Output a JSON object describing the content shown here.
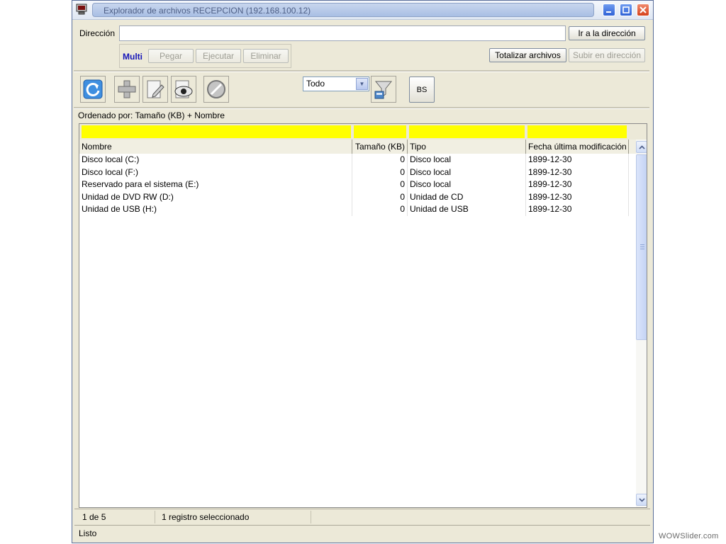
{
  "window": {
    "title": "Explorador de archivos RECEPCION (192.168.100.12)",
    "controls": {
      "minimize": "_",
      "maximize": "□",
      "close": "X"
    }
  },
  "address": {
    "label": "Dirección",
    "value": "",
    "go_button": "Ir a la dirección"
  },
  "multi": {
    "label": "Multi",
    "buttons": [
      "Pegar",
      "Ejecutar",
      "Eliminar"
    ]
  },
  "actions": {
    "totalize": "Totalizar archivos",
    "go_up": "Subir en dirección"
  },
  "toolbar": {
    "icons": [
      "refresh-icon",
      "add-icon",
      "edit-icon",
      "view-icon",
      "cancel-icon"
    ],
    "filter_select": "Todo",
    "filter_icon": "filter-icon",
    "bs_button": "BS"
  },
  "sort": {
    "text": "Ordenado por: Tamaño (KB)  +  Nombre"
  },
  "grid": {
    "columns": [
      "Nombre",
      "Tamaño (KB)",
      "Tipo",
      "Fecha última modificación"
    ],
    "rows": [
      [
        "Disco local (C:)",
        "0",
        "Disco local",
        "1899-12-30"
      ],
      [
        "Disco local (F:)",
        "0",
        "Disco local",
        "1899-12-30"
      ],
      [
        "Reservado para el sistema (E:)",
        "0",
        "Disco local",
        "1899-12-30"
      ],
      [
        "Unidad de DVD RW (D:)",
        "0",
        "Unidad de CD",
        "1899-12-30"
      ],
      [
        "Unidad de USB (H:)",
        "0",
        "Unidad de USB",
        "1899-12-30"
      ]
    ]
  },
  "status": {
    "position": "1 de 5",
    "selection": "1 registro seleccionado",
    "state": "Listo"
  },
  "colors": {
    "filter_highlight": "#ffff00",
    "multi_label": "#1515b8",
    "window_bg": "#ece9d8"
  },
  "watermark": "WOWSlider.com"
}
